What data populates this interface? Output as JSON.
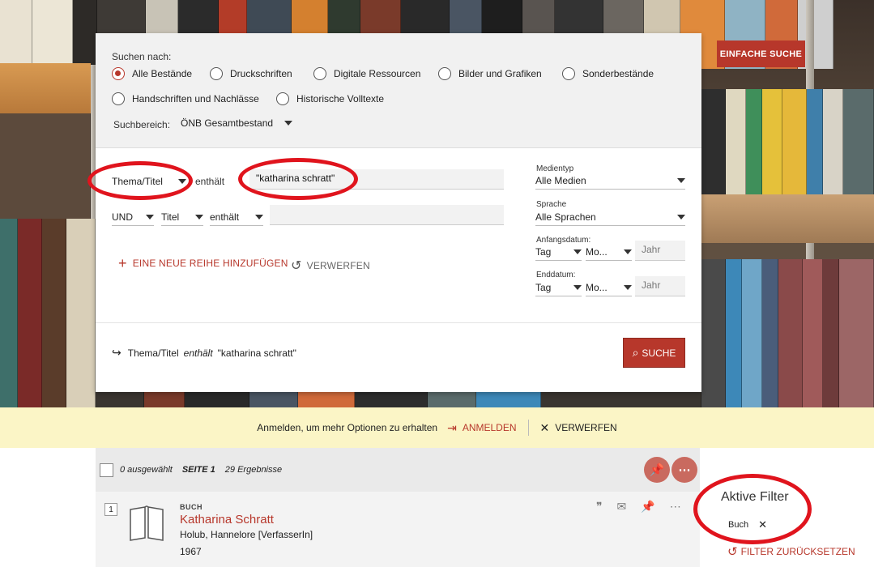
{
  "scope": {
    "label": "Suchen nach:",
    "options": [
      "Alle Bestände",
      "Druckschriften",
      "Digitale Ressourcen",
      "Bilder und Grafiken",
      "Sonderbestände",
      "Handschriften und Nachlässe",
      "Historische Volltexte"
    ],
    "selected": "Alle Bestände",
    "area_label": "Suchbereich:",
    "area_value": "ÖNB Gesamtbestand"
  },
  "simple_search_button": "EINFACHE SUCHE",
  "query": {
    "row1": {
      "field": "Thema/Titel",
      "operator": "enthält",
      "value": "\"katharina schratt\""
    },
    "row2": {
      "boolean": "UND",
      "field": "Titel",
      "operator": "enthält",
      "value": ""
    },
    "add_row": "EINE NEUE REIHE HINZUFÜGEN",
    "discard": "VERWERFEN"
  },
  "filters": {
    "media_label": "Medientyp",
    "media_value": "Alle Medien",
    "language_label": "Sprache",
    "language_value": "Alle Sprachen",
    "start_label": "Anfangsdatum:",
    "end_label": "Enddatum:",
    "day": "Tag",
    "month": "Mo...",
    "year_placeholder": "Jahr"
  },
  "summary": {
    "field": "Thema/Titel",
    "operator": "enthält",
    "value": "\"katharina schratt\""
  },
  "search_button": "SUCHE",
  "login_bar": {
    "text": "Anmelden, um mehr Optionen zu erhalten",
    "login": "ANMELDEN",
    "dismiss": "VERWERFEN"
  },
  "results": {
    "selected": "0 ausgewählt",
    "page": "SEITE 1",
    "count": "29 Ergebnisse",
    "items": [
      {
        "index": "1",
        "type": "BUCH",
        "title": "Katharina Schratt",
        "author": "Holub, Hannelore [VerfasserIn]",
        "year": "1967"
      }
    ]
  },
  "active_filters": {
    "title": "Aktive Filter",
    "chip": "Buch",
    "reset": "FILTER ZURÜCKSETZEN"
  },
  "colors": {
    "accent": "#b7372b",
    "annotation": "#e0141d",
    "banner": "#fbf5c6"
  }
}
